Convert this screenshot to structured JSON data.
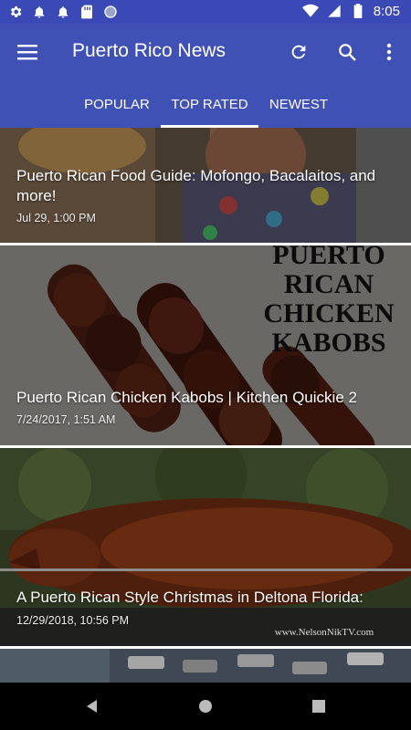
{
  "status_bar": {
    "time": "8:05",
    "left_icons": [
      "gear-icon",
      "notification-bell-icon",
      "notification-bell-icon",
      "sd-card-icon",
      "circle-icon"
    ],
    "right_icons": [
      "wifi-icon",
      "cell-signal-icon",
      "battery-icon"
    ]
  },
  "toolbar": {
    "title": "Puerto Rico News",
    "background": "#3f51b5",
    "actions": [
      "refresh-icon",
      "search-icon",
      "more-vert-icon"
    ]
  },
  "tabs": [
    {
      "label": "POPULAR",
      "selected": false
    },
    {
      "label": "TOP RATED",
      "selected": true
    },
    {
      "label": "NEWEST",
      "selected": false
    }
  ],
  "articles": [
    {
      "title": "Puerto Rican Food Guide: Mofongo, Bacalaitos, and more!",
      "date": "Jul 29, 1:00 PM"
    },
    {
      "title": "Puerto Rican Chicken Kabobs | Kitchen Quickie 2",
      "date": "7/24/2017, 1:51 AM",
      "image_text": [
        "PUERTO",
        "RICAN",
        "CHICKEN",
        "KABOBS"
      ]
    },
    {
      "title": "A Puerto Rican Style Christmas in Deltona Florida:",
      "date": "12/29/2018, 10:56 PM",
      "watermark": "www.NelsonNikTV.com"
    }
  ],
  "nav_bar": {
    "icons": [
      "back-icon",
      "home-icon",
      "recents-icon"
    ]
  }
}
